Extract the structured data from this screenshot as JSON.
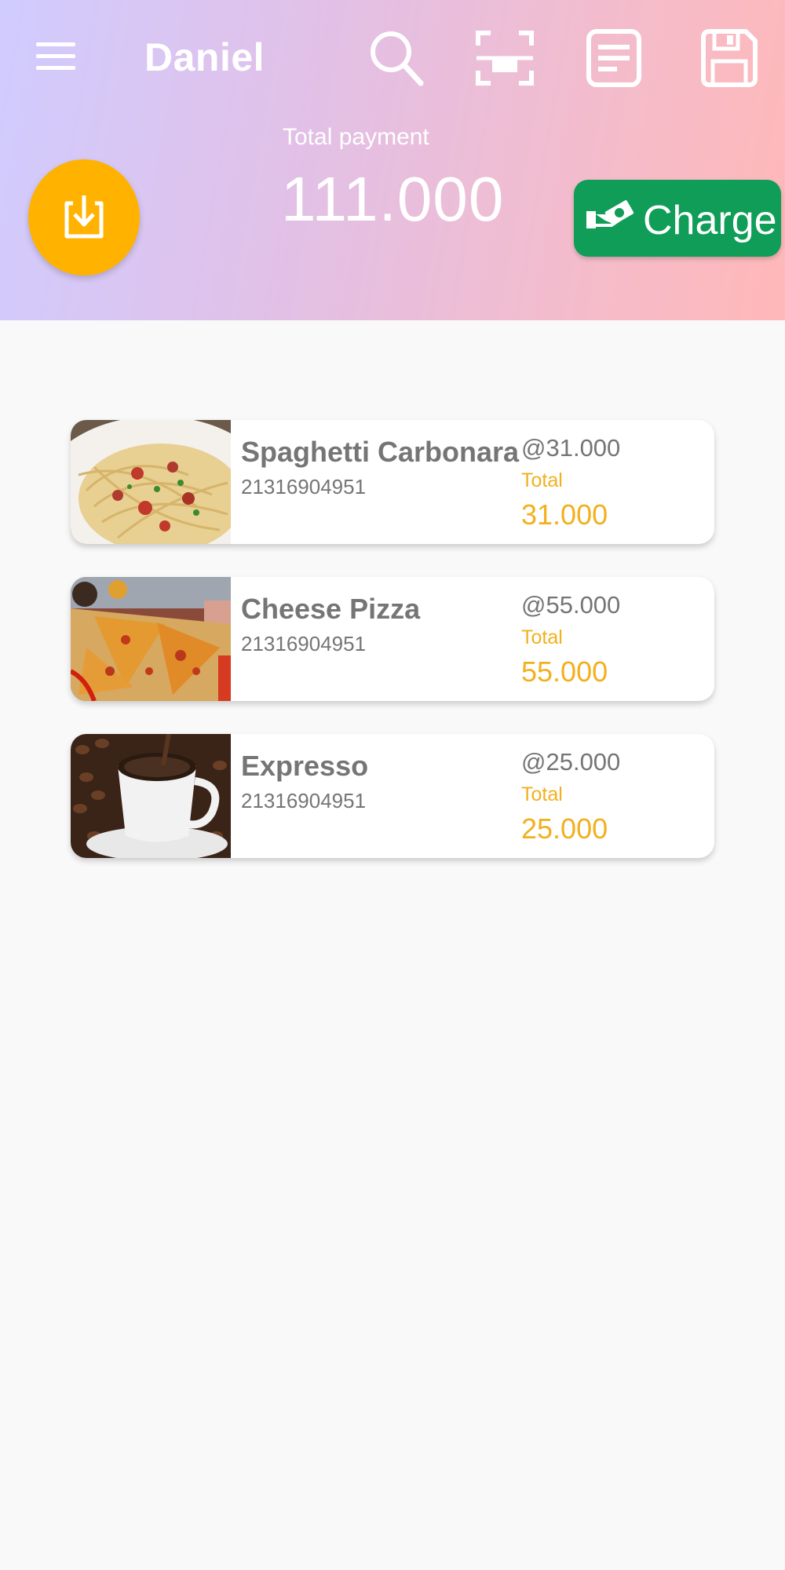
{
  "header": {
    "user_name": "Daniel",
    "total_label": "Total payment",
    "total_value": "111.000",
    "charge_label": "Charge",
    "icons": [
      "menu-icon",
      "search-icon",
      "barcode-scan-icon",
      "receipt-icon",
      "save-icon",
      "download-icon",
      "cash-hand-icon"
    ]
  },
  "colors": {
    "header_gradient_start": "#d0ccff",
    "header_gradient_end": "#ffb8b8",
    "fab": "#ffb300",
    "charge": "#0f9d58",
    "accent_total": "#f2b01e",
    "text_gray": "#757575",
    "background": "#f9f9f9"
  },
  "items": [
    {
      "name": "Spaghetti Carbonara",
      "code": "21316904951",
      "unit_price": "@31.000",
      "total_label": "Total",
      "total": "31.000"
    },
    {
      "name": "Cheese Pizza",
      "code": "21316904951",
      "unit_price": "@55.000",
      "total_label": "Total",
      "total": "55.000"
    },
    {
      "name": "Expresso",
      "code": "21316904951",
      "unit_price": "@25.000",
      "total_label": "Total",
      "total": "25.000"
    }
  ]
}
